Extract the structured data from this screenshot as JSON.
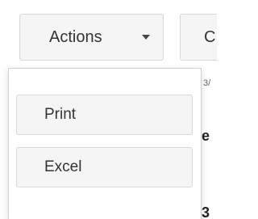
{
  "toolbar": {
    "actions_label": "Actions",
    "partial_button_label": "C"
  },
  "background": {
    "small_text": "3/",
    "row_text_1": "e",
    "row_text_2": "3"
  },
  "menu": {
    "items": [
      {
        "label": "Print"
      },
      {
        "label": "Excel"
      }
    ]
  },
  "colors": {
    "button_bg": "#f5f5f5",
    "button_border": "#d7d7d7",
    "text": "#333333"
  }
}
